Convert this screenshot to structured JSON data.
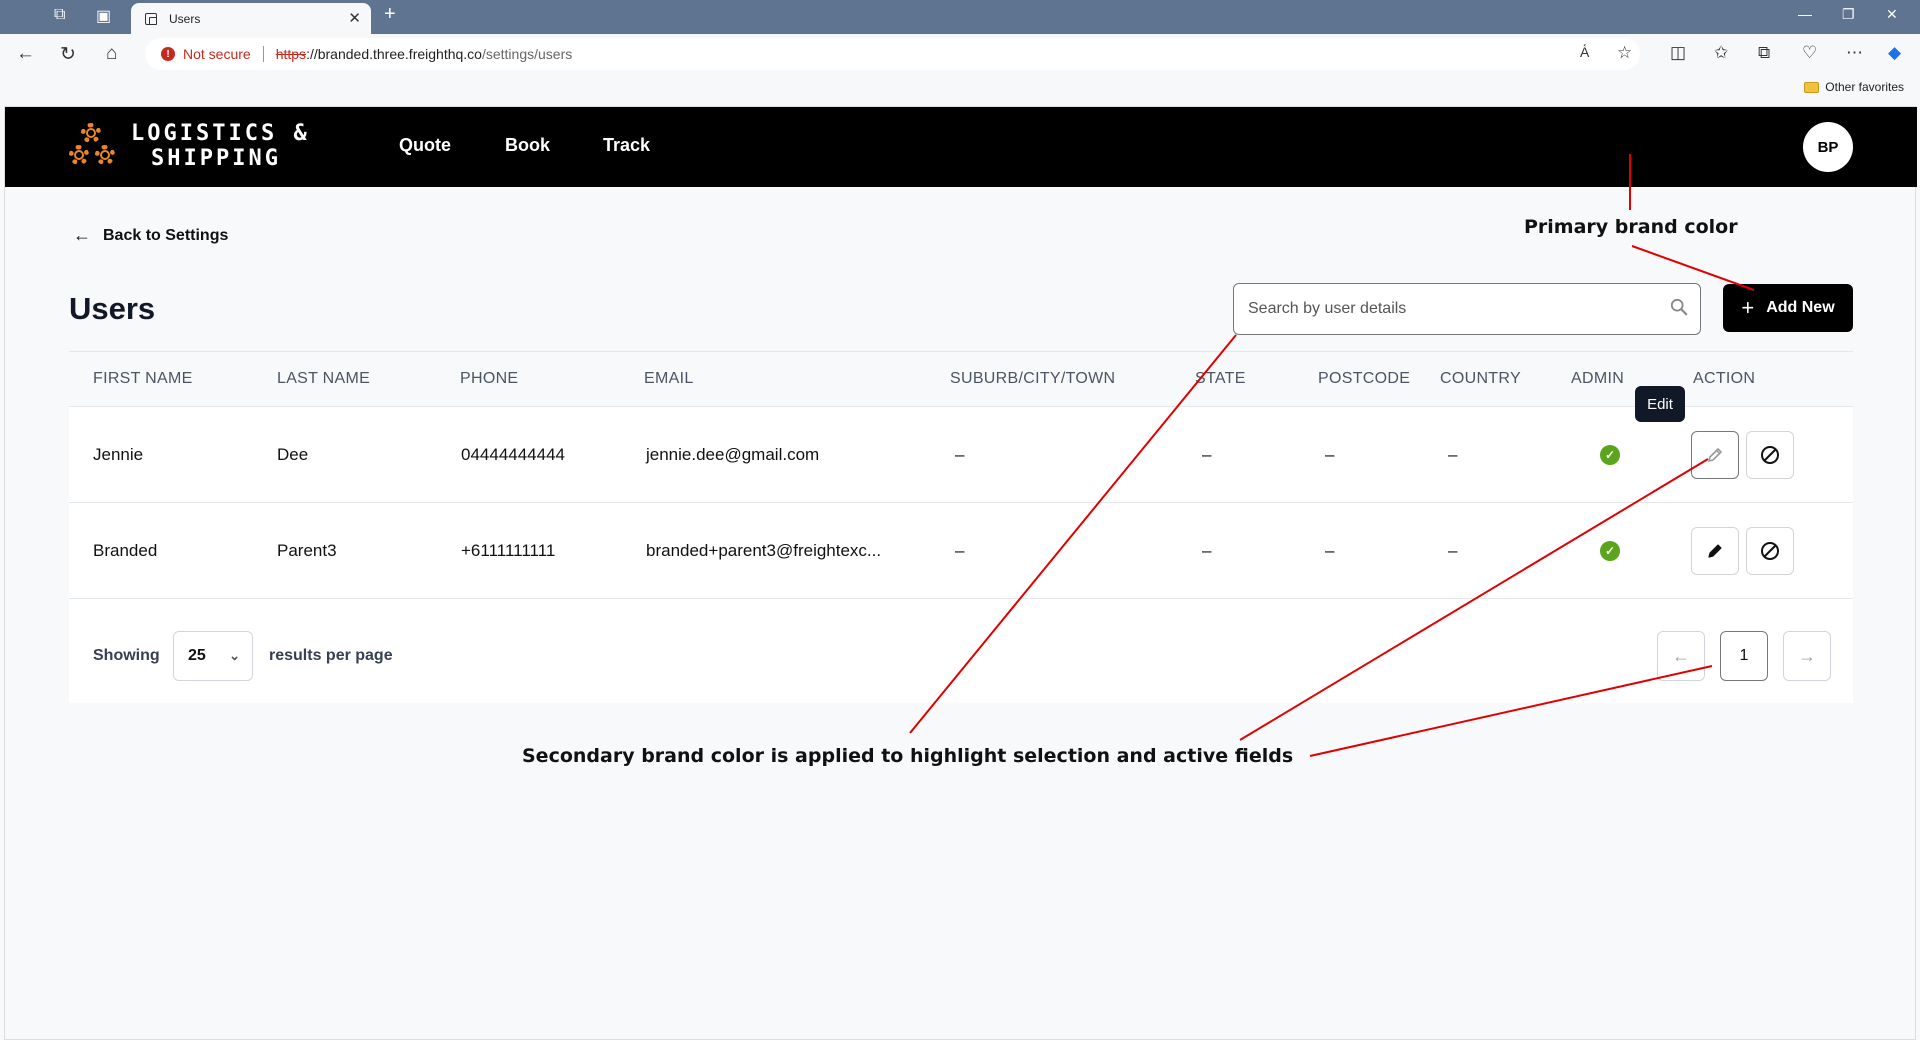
{
  "browser": {
    "tab_title": "Users",
    "security_label": "Not secure",
    "url_scheme": "https",
    "url_host": "://branded.three.freighthq.co",
    "url_path": "/settings/users",
    "favorites_folder": "Other favorites"
  },
  "header": {
    "logo_line1": "LOGISTICS &",
    "logo_line2": "SHIPPING",
    "nav": [
      "Quote",
      "Book",
      "Track"
    ],
    "avatar_initials": "BP"
  },
  "page": {
    "back_label": "Back to Settings",
    "title": "Users",
    "search_placeholder": "Search by user details",
    "add_new_label": "Add New"
  },
  "table": {
    "columns": [
      "FIRST NAME",
      "LAST NAME",
      "PHONE",
      "EMAIL",
      "SUBURB/CITY/TOWN",
      "STATE",
      "POSTCODE",
      "COUNTRY",
      "ADMIN",
      "ACTION"
    ],
    "rows": [
      {
        "first_name": "Jennie",
        "last_name": "Dee",
        "phone": "04444444444",
        "email": "jennie.dee@gmail.com",
        "suburb": "–",
        "state": "–",
        "postcode": "–",
        "country": "–",
        "admin": true
      },
      {
        "first_name": "Branded",
        "last_name": "Parent3",
        "phone": "+6111111111",
        "email": "branded+parent3@freightexc...",
        "suburb": "–",
        "state": "–",
        "postcode": "–",
        "country": "–",
        "admin": true
      }
    ],
    "tooltip": "Edit"
  },
  "pagination": {
    "showing_label": "Showing",
    "per_page": "25",
    "per_page_suffix": "results per page",
    "current_page": "1"
  },
  "annotations": {
    "primary": "Primary brand color",
    "secondary": "Secondary brand color is applied to highlight selection and active fields"
  },
  "colors": {
    "primary_brand": "#000000",
    "secondary_brand": "#777777",
    "logo_accent": "#e9862a",
    "admin_check": "#5aa51c",
    "annotation_line": "#e00000"
  }
}
